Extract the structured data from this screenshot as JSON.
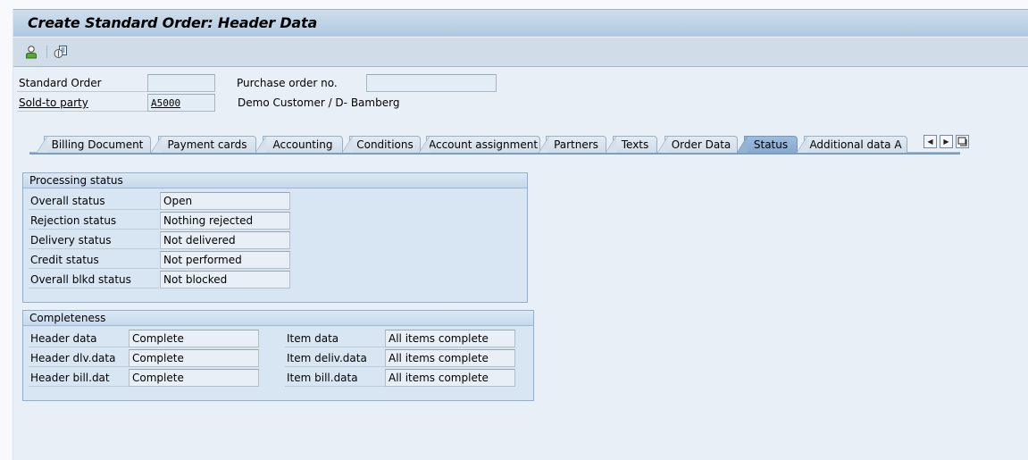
{
  "window": {
    "title": "Create Standard Order: Header Data"
  },
  "toolbar": {
    "buttons": [
      {
        "icon": "person-icon",
        "tooltip": ""
      },
      {
        "icon": "document-overview-icon",
        "tooltip": ""
      }
    ]
  },
  "header": {
    "standard_order_label": "Standard Order",
    "standard_order_value": "",
    "purchase_order_label": "Purchase order no.",
    "purchase_order_value": "",
    "sold_to_label": "Sold-to party",
    "sold_to_value": "A5000",
    "sold_to_desc": "Demo Customer / D- Bamberg"
  },
  "tabs": [
    {
      "label": "Billing Document",
      "active": false
    },
    {
      "label": "Payment cards",
      "active": false
    },
    {
      "label": "Accounting",
      "active": false
    },
    {
      "label": "Conditions",
      "active": false
    },
    {
      "label": "Account assignment",
      "active": false
    },
    {
      "label": "Partners",
      "active": false
    },
    {
      "label": "Texts",
      "active": false
    },
    {
      "label": "Order Data",
      "active": false
    },
    {
      "label": "Status",
      "active": true
    },
    {
      "label": "Additional data A",
      "active": false
    }
  ],
  "tab_nav": {
    "prev": "◀",
    "next": "▶",
    "list": "tab-list"
  },
  "processing_status": {
    "title": "Processing status",
    "rows": [
      {
        "label": "Overall status",
        "value": "Open"
      },
      {
        "label": "Rejection status",
        "value": "Nothing rejected"
      },
      {
        "label": "Delivery status",
        "value": "Not delivered"
      },
      {
        "label": "Credit status",
        "value": "Not performed"
      },
      {
        "label": "Overall blkd status",
        "value": "Not blocked"
      }
    ]
  },
  "completeness": {
    "title": "Completeness",
    "left": [
      {
        "label": "Header data",
        "value": "Complete"
      },
      {
        "label": "Header dlv.data",
        "value": "Complete"
      },
      {
        "label": "Header bill.dat",
        "value": "Complete"
      }
    ],
    "right": [
      {
        "label": "Item data",
        "value": "All items complete"
      },
      {
        "label": "Item deliv.data",
        "value": "All items complete"
      },
      {
        "label": "Item bill.data",
        "value": "All items complete"
      }
    ]
  },
  "colors": {
    "accent": "#87a9cf",
    "title_bar": "#b0c8e0",
    "background": "#e8eff7"
  }
}
